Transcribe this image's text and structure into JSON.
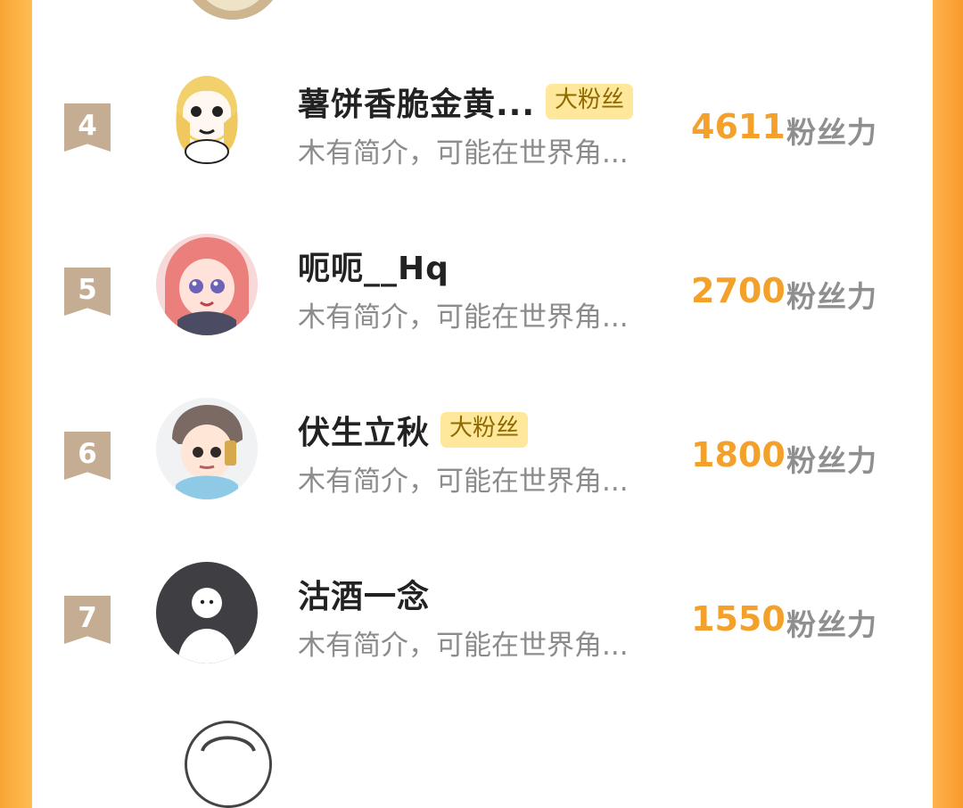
{
  "rows": [
    {
      "rank": "4",
      "name": "薯饼香脆金黄...",
      "tag": "大粉丝",
      "desc": "木有简介，可能在世界角...",
      "score": "4611",
      "score_label": "粉丝力"
    },
    {
      "rank": "5",
      "name": "呃呃__Hq",
      "tag": "",
      "desc": "木有简介，可能在世界角...",
      "score": "2700",
      "score_label": "粉丝力"
    },
    {
      "rank": "6",
      "name": "伏生立秋",
      "tag": "大粉丝",
      "desc": "木有简介，可能在世界角...",
      "score": "1800",
      "score_label": "粉丝力"
    },
    {
      "rank": "7",
      "name": "沽酒一念",
      "tag": "",
      "desc": "木有简介，可能在世界角...",
      "score": "1550",
      "score_label": "粉丝力"
    }
  ]
}
